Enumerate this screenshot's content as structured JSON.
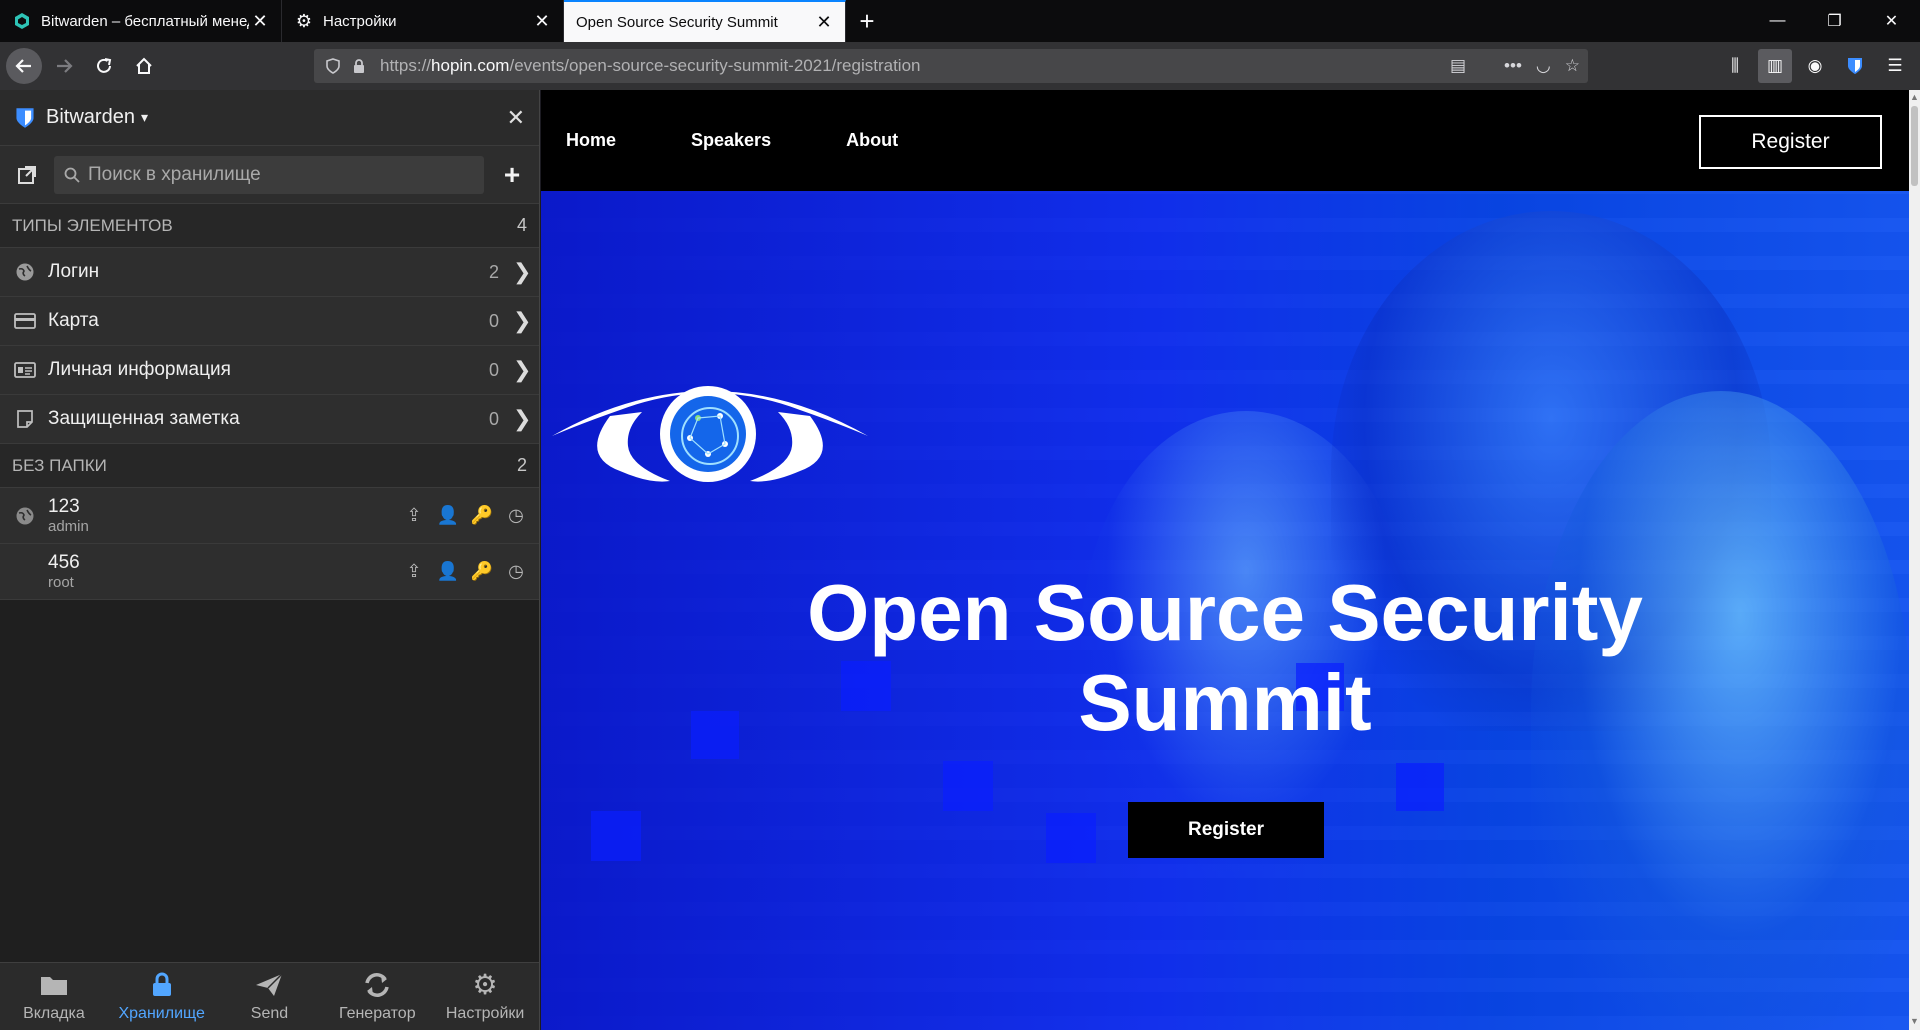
{
  "tabs": [
    {
      "title": "Bitwarden – бесплатный менеджер паролей",
      "active": false,
      "icon": "bitwarden-icon"
    },
    {
      "title": "Настройки",
      "active": false,
      "icon": "gear-icon"
    },
    {
      "title": "Open Source Security Summit",
      "active": true,
      "icon": ""
    }
  ],
  "address_bar": {
    "url_prefix": "https://",
    "url_host": "hopin.com",
    "url_path": "/events/open-source-security-summit-2021/registration"
  },
  "sidebar": {
    "title": "Bitwarden",
    "search_placeholder": "Поиск в хранилище",
    "types_heading": "ТИПЫ ЭЛЕМЕНТОВ",
    "types_count": "4",
    "types": [
      {
        "label": "Логин",
        "count": "2",
        "icon": "globe-icon"
      },
      {
        "label": "Карта",
        "count": "0",
        "icon": "credit-card-icon"
      },
      {
        "label": "Личная информация",
        "count": "0",
        "icon": "id-card-icon"
      },
      {
        "label": "Защищенная заметка",
        "count": "0",
        "icon": "note-icon"
      }
    ],
    "folder_heading": "БЕЗ ПАПКИ",
    "folder_count": "2",
    "items": [
      {
        "name": "123",
        "username": "admin"
      },
      {
        "name": "456",
        "username": "root"
      }
    ],
    "footer": [
      {
        "label": "Вкладка",
        "icon": "folder-icon",
        "active": false
      },
      {
        "label": "Хранилище",
        "icon": "lock-icon",
        "active": true
      },
      {
        "label": "Send",
        "icon": "paper-plane-icon",
        "active": false
      },
      {
        "label": "Генератор",
        "icon": "refresh-icon",
        "active": false
      },
      {
        "label": "Настройки",
        "icon": "gears-icon",
        "active": false
      }
    ]
  },
  "site": {
    "nav": [
      "Home",
      "Speakers",
      "About"
    ],
    "register_label": "Register",
    "hero_title_line1": "Open Source Security",
    "hero_title_line2": "Summit",
    "hero_button": "Register"
  },
  "colors": {
    "accent": "#0a84ff",
    "sidebar_active": "#52a6ff",
    "hero_blue": "#0b22ff"
  }
}
